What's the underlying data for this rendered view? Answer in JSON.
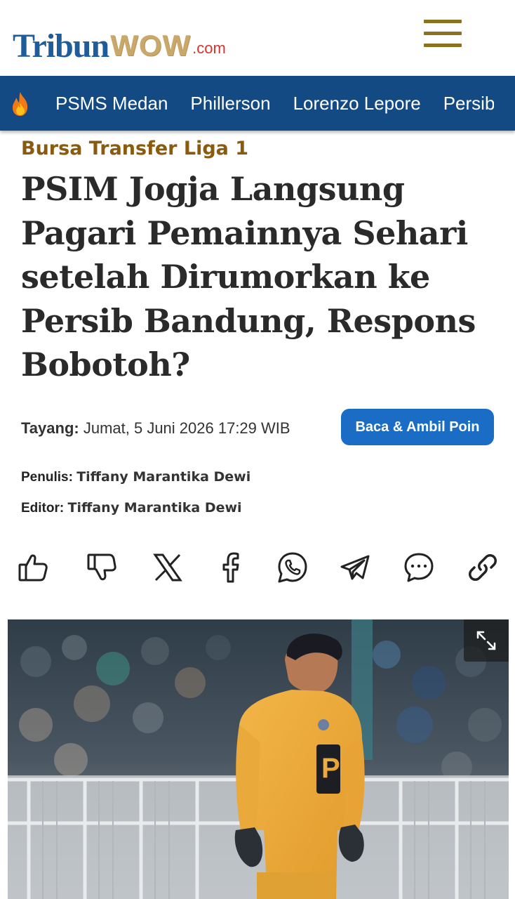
{
  "header": {
    "logo_tribun": "Tribun",
    "logo_wow": "WOW",
    "logo_com": ".com"
  },
  "trending": {
    "items": [
      "PSMS Medan",
      "Phillerson",
      "Lorenzo Lepore",
      "Persib B"
    ]
  },
  "article": {
    "category": "Bursa Transfer Liga 1",
    "title": "PSIM Jogja Langsung Pagari Pemainnya Sehari setelah Dirumorkan ke Persib Bandung, Respons Bobotoh?",
    "tayang_label": "Tayang:",
    "tayang_value": "Jumat, 5 Juni 2026 17:29 WIB",
    "baca_button": "Baca & Ambil Poin",
    "penulis_label": "Penulis:",
    "penulis_value": "Tiffany Marantika Dewi",
    "editor_label": "Editor:",
    "editor_value": "Tiffany Marantika Dewi"
  },
  "share_icons": [
    "like-icon",
    "dislike-icon",
    "x-icon",
    "facebook-icon",
    "whatsapp-icon",
    "telegram-icon",
    "comment-icon",
    "link-icon"
  ],
  "colors": {
    "brand_blue": "#134a84",
    "category": "#8a5a0e",
    "button": "#1a6cc5",
    "menu": "#8a7220"
  }
}
